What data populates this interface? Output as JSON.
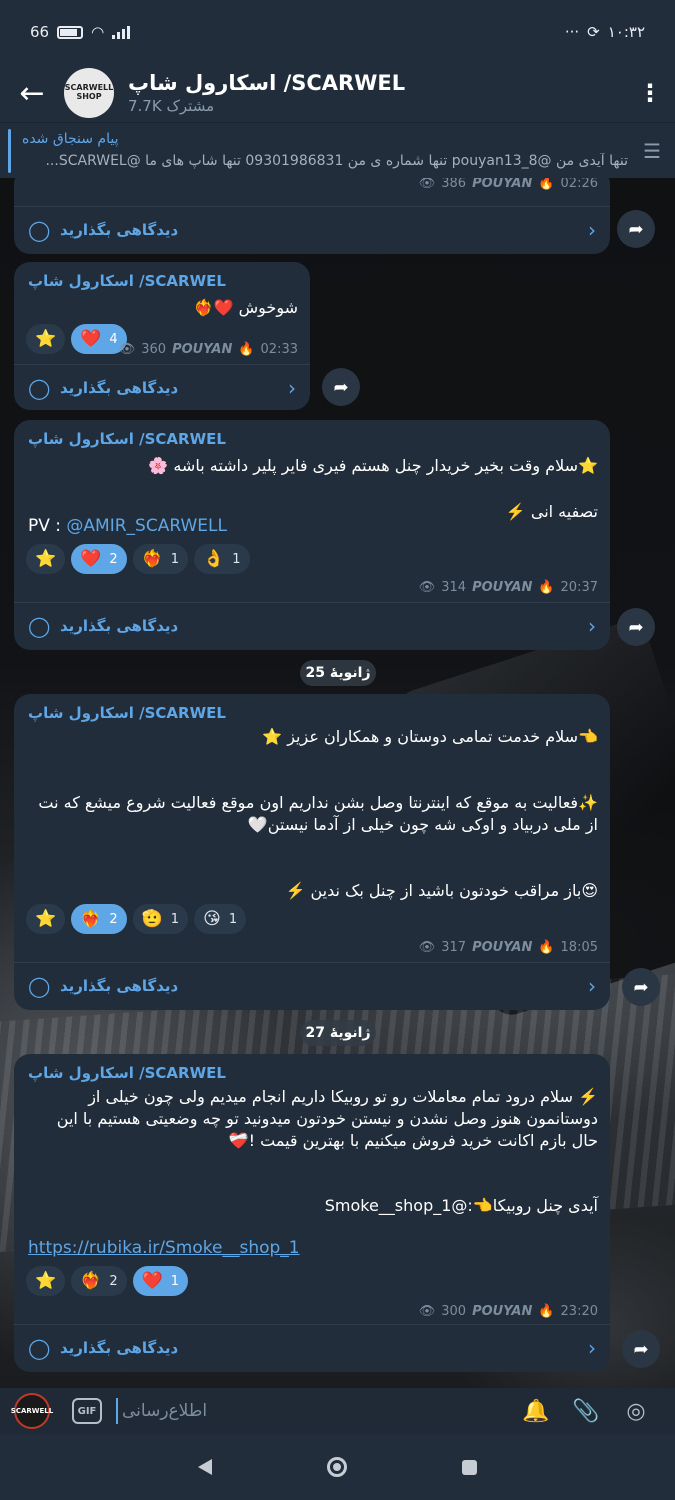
{
  "status": {
    "battery": "66",
    "time": "۱۰:۳۲",
    "dots": "···"
  },
  "header": {
    "back_icon": "←",
    "title": "اسکارول شاپ /SCARWEL",
    "subscribers": "7.7K مشترک",
    "avatar_text": "SCARWELL SHOP",
    "menu_icon": "⋮"
  },
  "pinned": {
    "title": "پیام سنجاق شده",
    "text": "تنها آیدی من @pouyan13_8 تنها شماره ی من 09301986831 تنها شاپ های ما @SCARWEL..."
  },
  "messages": [
    {
      "views": "386",
      "author": "POUYAN",
      "time": "02:26",
      "comment_label": "دیدگاهی بگذارید"
    },
    {
      "sender": "اسکارول شاپ /SCARWEL",
      "text": "شوخوش ❤️❤️‍🔥",
      "reactions": [
        {
          "emoji": "⭐",
          "count": ""
        },
        {
          "emoji": "❤️",
          "count": "4"
        }
      ],
      "views": "360",
      "author": "POUYAN",
      "time": "02:33",
      "comment_label": "دیدگاهی بگذارید"
    },
    {
      "sender": "اسکارول شاپ /SCARWEL",
      "text": "⭐️سلام وقت بخیر خریدار چنل هستم فیری فایر پلیر داشته باشه 🌸\n\nتصفیه انی ⚡️",
      "pv_label": "PV :",
      "pv_handle": "@AMIR_SCARWELL",
      "reactions": [
        {
          "emoji": "⭐",
          "count": ""
        },
        {
          "emoji": "❤️",
          "count": "2"
        },
        {
          "emoji": "❤️‍🔥",
          "count": "1"
        },
        {
          "emoji": "👌",
          "count": "1"
        }
      ],
      "views": "314",
      "author": "POUYAN",
      "time": "20:37",
      "comment_label": "دیدگاهی بگذارید"
    },
    {
      "date_chip": "25 ژانویهٔ",
      "sender": "اسکارول شاپ /SCARWEL",
      "text": "👈سلام خدمت تمامی دوستان و همکاران عزیز ⭐️\n\n\n✨فعالیت به موقع که اینترنتا وصل بشن نداریم اون موقع فعالیت شروع میشع که نت از ملی دربیاد و اوکی شه چون خیلی از آدما نیستن🤍\n\n\n😍باز مراقب خودتون باشید از چنل بک ندین ⚡️",
      "reactions": [
        {
          "emoji": "⭐",
          "count": ""
        },
        {
          "emoji": "❤️‍🔥",
          "count": "2"
        },
        {
          "emoji": "🫡",
          "count": "1"
        },
        {
          "emoji": "😘",
          "count": "1"
        }
      ],
      "views": "317",
      "author": "POUYAN",
      "time": "18:05",
      "comment_label": "دیدگاهی بگذارید"
    },
    {
      "date_chip": "27 ژانویهٔ",
      "sender": "اسکارول شاپ /SCARWEL",
      "text": "⚡️ سلام درود تمام معاملات رو تو روبیکا داریم انجام میدیم ولی چون خیلی از دوستانمون هنوز وصل نشدن و نیستن خودتون میدونید تو چه وضعیتی هستیم با این حال بازم اکانت خرید فروش میکنیم با بهترین قیمت !❤️‍🩹",
      "rubika_line": "آیدی چنل روبیکا👈:@Smoke__shop_1",
      "link": "https://rubika.ir/Smoke__shop_1",
      "reactions": [
        {
          "emoji": "⭐",
          "count": ""
        },
        {
          "emoji": "❤️‍🔥",
          "count": "2"
        },
        {
          "emoji": "❤️",
          "count": "1"
        }
      ],
      "views": "300",
      "author": "POUYAN",
      "time": "23:20",
      "comment_label": "دیدگاهی بگذارید"
    }
  ],
  "input": {
    "placeholder": "اطلاع‌رسانی",
    "gif": "GIF",
    "avatar_text": "SCARWELL"
  },
  "icons": {
    "share": "➦",
    "comment": "◯",
    "chevron": "›",
    "eye": "👁",
    "flame": "🔥"
  }
}
